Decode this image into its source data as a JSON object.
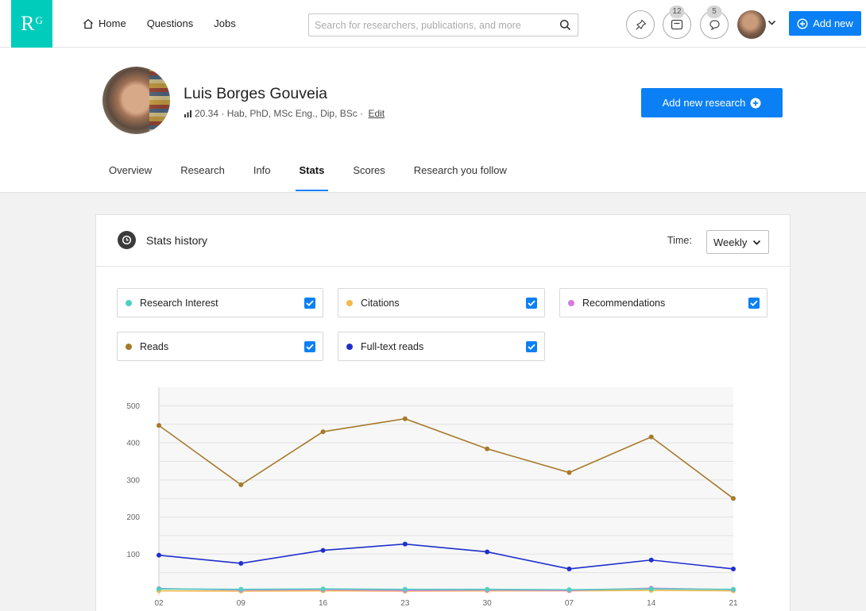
{
  "nav": {
    "logo_text": "R",
    "logo_sup": "G",
    "links": [
      {
        "label": "Home",
        "icon": "home-icon"
      },
      {
        "label": "Questions"
      },
      {
        "label": "Jobs"
      }
    ],
    "search_placeholder": "Search for researchers, publications, and more",
    "messages_count": "12",
    "notifications_count": "5",
    "add_new_label": "Add new"
  },
  "profile": {
    "name": "Luis Borges Gouveia",
    "score": "20.34",
    "degrees": "Hab, PhD, MSc Eng., Dip, BSc",
    "separator": " · ",
    "edit_label": "Edit",
    "add_research_label": "Add new research"
  },
  "tabs": [
    {
      "label": "Overview",
      "active": false
    },
    {
      "label": "Research",
      "active": false
    },
    {
      "label": "Info",
      "active": false
    },
    {
      "label": "Stats",
      "active": true
    },
    {
      "label": "Scores",
      "active": false
    },
    {
      "label": "Research you follow",
      "active": false
    }
  ],
  "stats": {
    "title": "Stats history",
    "time_label": "Time:",
    "time_value": "Weekly",
    "legend": [
      {
        "label": "Research Interest",
        "color": "#4fcfc1",
        "checked": true
      },
      {
        "label": "Citations",
        "color": "#f5b94a",
        "checked": true
      },
      {
        "label": "Recommendations",
        "color": "#d57be0",
        "checked": true
      },
      {
        "label": "Reads",
        "color": "#a67a2a",
        "checked": true
      },
      {
        "label": "Full-text reads",
        "color": "#1f2fcc",
        "checked": true
      }
    ]
  },
  "chart_data": {
    "type": "line",
    "categories": [
      "02",
      "09",
      "16",
      "23",
      "30",
      "07",
      "14",
      "21"
    ],
    "y_ticks": [
      100,
      200,
      300,
      400,
      500
    ],
    "ylim": [
      0,
      550
    ],
    "grid": true,
    "series": [
      {
        "name": "Reads",
        "color": "#a67a2a",
        "values": [
          447,
          287,
          430,
          465,
          384,
          320,
          416,
          250
        ]
      },
      {
        "name": "Full-text reads",
        "color": "#1f2fcc",
        "values": [
          97,
          75,
          110,
          127,
          106,
          60,
          84,
          60
        ]
      },
      {
        "name": "Research Interest",
        "color": "#4fcfc1",
        "values": [
          6,
          5,
          6,
          5,
          5,
          4,
          6,
          5
        ]
      },
      {
        "name": "Recommendations",
        "color": "#d57be0",
        "values": [
          7,
          3,
          4,
          2,
          3,
          2,
          8,
          4
        ]
      },
      {
        "name": "Citations",
        "color": "#f5b94a",
        "values": [
          1,
          0,
          1,
          0,
          1,
          1,
          2,
          1
        ]
      }
    ]
  }
}
